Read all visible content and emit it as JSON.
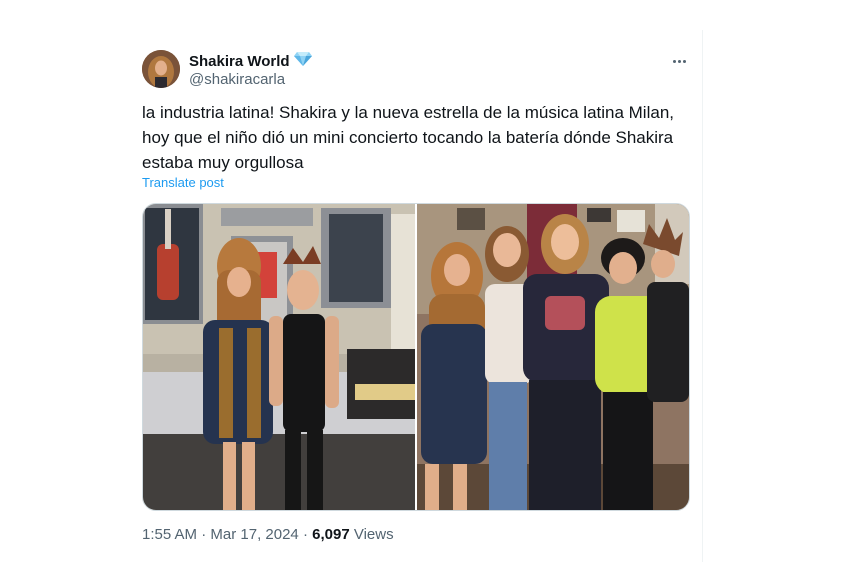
{
  "post": {
    "author_name": "Shakira World",
    "author_handle": "@shakiracarla",
    "verified_icon": "diamond-badge-icon",
    "text": "la industria latina! Shakira y la nueva estrella de la música latina Milan, hoy que el niño dió un mini concierto tocando la batería dónde Shakira estaba muy orgullosa",
    "translate_label": "Translate post",
    "time": "1:55 AM",
    "separator": "·",
    "date": "Mar 17, 2024",
    "views_count": "6,097",
    "views_label": "Views"
  },
  "colors": {
    "link": "#1d9bf0",
    "muted": "#536471",
    "text": "#0f1419"
  }
}
